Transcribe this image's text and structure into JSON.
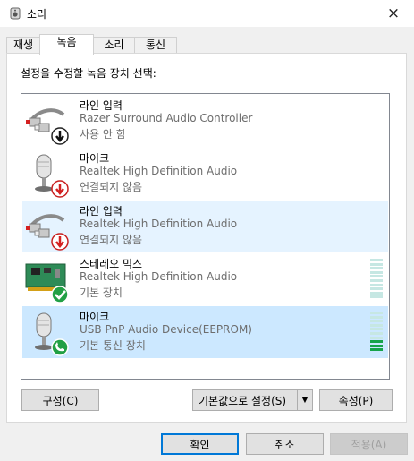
{
  "window": {
    "title": "소리",
    "close_icon": "×"
  },
  "tabs": [
    {
      "label": "재생"
    },
    {
      "label": "녹음",
      "active": true
    },
    {
      "label": "소리"
    },
    {
      "label": "통신"
    }
  ],
  "prompt": "설정을 수정할 녹음 장치 선택:",
  "devices": [
    {
      "name": "라인 입력",
      "desc": "Razer Surround Audio Controller",
      "status": "사용 안 함",
      "icon": "line-in-jack-icon",
      "badge": "disabled-badge"
    },
    {
      "name": "마이크",
      "desc": "Realtek High Definition Audio",
      "status": "연결되지 않음",
      "icon": "microphone-icon",
      "badge": "not-connected-badge"
    },
    {
      "name": "라인 입력",
      "desc": "Realtek High Definition Audio",
      "status": "연결되지 않음",
      "icon": "line-in-jack-icon",
      "badge": "not-connected-badge"
    },
    {
      "name": "스테레오 믹스",
      "desc": "Realtek High Definition Audio",
      "status": "기본 장치",
      "icon": "sound-card-icon",
      "badge": "default-check-badge",
      "level": 0
    },
    {
      "name": "마이크",
      "desc": "USB PnP Audio Device(EEPROM)",
      "status": "기본 통신 장치",
      "icon": "microphone-icon",
      "badge": "default-comm-phone-badge",
      "level": 0.25
    }
  ],
  "buttons": {
    "configure": "구성(C)",
    "set_default": "기본값으로 설정(S)",
    "set_default_arrow": "▼",
    "properties": "속성(P)",
    "ok": "확인",
    "cancel": "취소",
    "apply": "적용(A)"
  },
  "colors": {
    "selection": "#cce8ff",
    "hover": "#e5f3ff",
    "default_border": "#0078d7",
    "meter_off": "#c6e7e3",
    "meter_on": "#16a34a"
  }
}
